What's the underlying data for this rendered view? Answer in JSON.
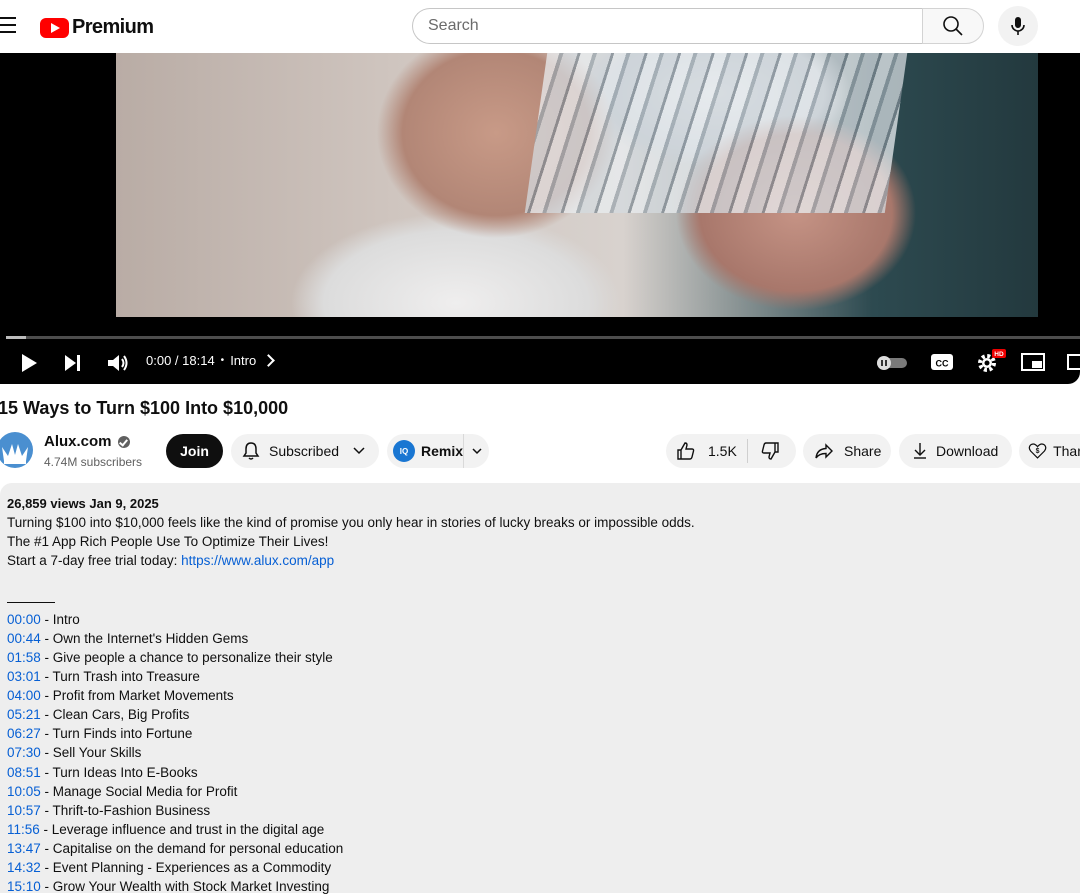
{
  "header": {
    "logo_text": "Premium",
    "search_placeholder": "Search"
  },
  "player": {
    "time": "0:00 / 18:14",
    "chapter": "Intro",
    "progress_fraction": 0.004
  },
  "video": {
    "title": "15 Ways to Turn $100 Into $10,000"
  },
  "channel": {
    "name": "Alux.com",
    "subscribers": "4.74M subscribers"
  },
  "actions": {
    "join": "Join",
    "subscribed": "Subscribed",
    "remix": "Remix",
    "likes": "1.5K",
    "share": "Share",
    "download": "Download",
    "thanks": "Thanks"
  },
  "description": {
    "views_date": "26,859 views  Jan 9, 2025",
    "line1": "Turning $100 into $10,000 feels like the kind of promise you only hear in stories of lucky breaks or impossible odds.",
    "line2": "The #1 App Rich People Use To Optimize Their Lives!",
    "line3_prefix": "Start a 7-day free trial today: ",
    "line3_link": "https://www.alux.com/app",
    "chapters": [
      {
        "time": "00:00",
        "title": " - Intro"
      },
      {
        "time": "00:44",
        "title": " - Own the Internet's Hidden Gems"
      },
      {
        "time": "01:58",
        "title": " - Give people a chance to personalize their style"
      },
      {
        "time": "03:01",
        "title": " - Turn Trash into Treasure"
      },
      {
        "time": "04:00",
        "title": " - Profit from Market Movements"
      },
      {
        "time": "05:21",
        "title": " - Clean Cars, Big Profits"
      },
      {
        "time": "06:27",
        "title": " - Turn Finds into Fortune"
      },
      {
        "time": "07:30",
        "title": " - Sell Your Skills"
      },
      {
        "time": "08:51",
        "title": " - Turn Ideas Into E-Books"
      },
      {
        "time": "10:05",
        "title": " - Manage Social Media for Profit"
      },
      {
        "time": "10:57",
        "title": " - Thrift-to-Fashion Business"
      },
      {
        "time": "11:56",
        "title": " - Leverage influence and trust in the digital age"
      },
      {
        "time": "13:47",
        "title": " - Capitalise on the demand for personal education"
      },
      {
        "time": "14:32",
        "title": " - Event Planning - Experiences as a Commodity"
      },
      {
        "time": "15:10",
        "title": " - Grow Your Wealth with Stock Market Investing"
      }
    ]
  }
}
